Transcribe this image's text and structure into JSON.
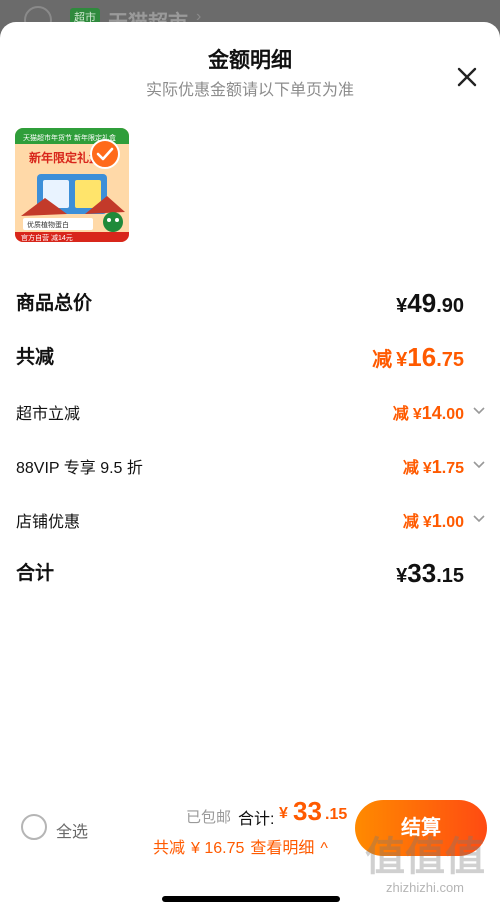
{
  "background": {
    "badge": "超市",
    "store_name": "天猫超市"
  },
  "sheet": {
    "title": "金额明细",
    "subtitle": "实际优惠金额请以下单页为准"
  },
  "product": {
    "top_banner": "天猫超市年货节 新年限定礼盒",
    "headline": "新年限定礼盒",
    "promo": "优质植物蛋白",
    "footer": "官方自营 减14元",
    "checked": true
  },
  "rows": [
    {
      "label": "商品总价",
      "prefix": "",
      "currency": "¥",
      "integer": "49",
      "decimal": ".90"
    },
    {
      "label": "共减",
      "prefix": "减",
      "currency": "¥",
      "integer": "16",
      "decimal": ".75"
    },
    {
      "label": "超市立减",
      "prefix": "减",
      "currency": "¥",
      "integer": "14",
      "decimal": ".00"
    },
    {
      "label": "88VIP 专享 9.5 折",
      "prefix": "减",
      "currency": "¥",
      "integer": "1",
      "decimal": ".75"
    },
    {
      "label": "店铺优惠",
      "prefix": "减",
      "currency": "¥",
      "integer": "1",
      "decimal": ".00"
    },
    {
      "label": "合计",
      "prefix": "",
      "currency": "¥",
      "integer": "33",
      "decimal": ".15"
    }
  ],
  "bottom": {
    "select_all": "全选",
    "shipping": "已包邮",
    "total_label": "合计:",
    "total_currency": "¥",
    "total_integer": "33",
    "total_decimal": ".15",
    "save_prefix": "共减",
    "save_amount": "¥ 16.75",
    "detail_link": "查看明细",
    "checkout": "结算"
  },
  "watermark": {
    "text": "值值值",
    "url": "zhizhizhi.com"
  },
  "colors": {
    "accent": "#ff5a00",
    "checkout_start": "#ff8a00",
    "checkout_end": "#ff4b12"
  }
}
